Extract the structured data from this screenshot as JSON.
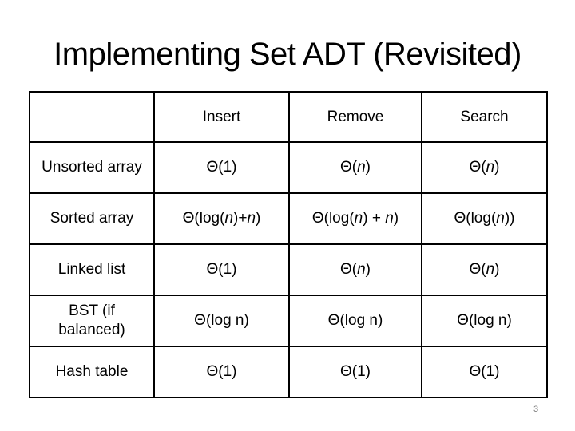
{
  "slide": {
    "title": "Implementing Set ADT (Revisited)",
    "page_number": "3"
  },
  "table": {
    "header": [
      "",
      "Insert",
      "Remove",
      "Search"
    ],
    "rows": [
      {
        "label": "Unsorted array",
        "insert": "Θ(1)",
        "remove": "Θ(n)",
        "search": "Θ(n)"
      },
      {
        "label": "Sorted array",
        "insert": "Θ(log(n)+n)",
        "remove": "Θ(log(n) + n)",
        "search": "Θ(log(n))"
      },
      {
        "label": "Linked list",
        "insert": "Θ(1)",
        "remove": "Θ(n)",
        "search": "Θ(n)"
      },
      {
        "label": "BST (if balanced)",
        "insert": "Θ(log n)",
        "remove": "Θ(log n)",
        "search": "Θ(log n)"
      },
      {
        "label": "Hash table",
        "insert": "Θ(1)",
        "remove": "Θ(1)",
        "search": "Θ(1)"
      }
    ]
  }
}
